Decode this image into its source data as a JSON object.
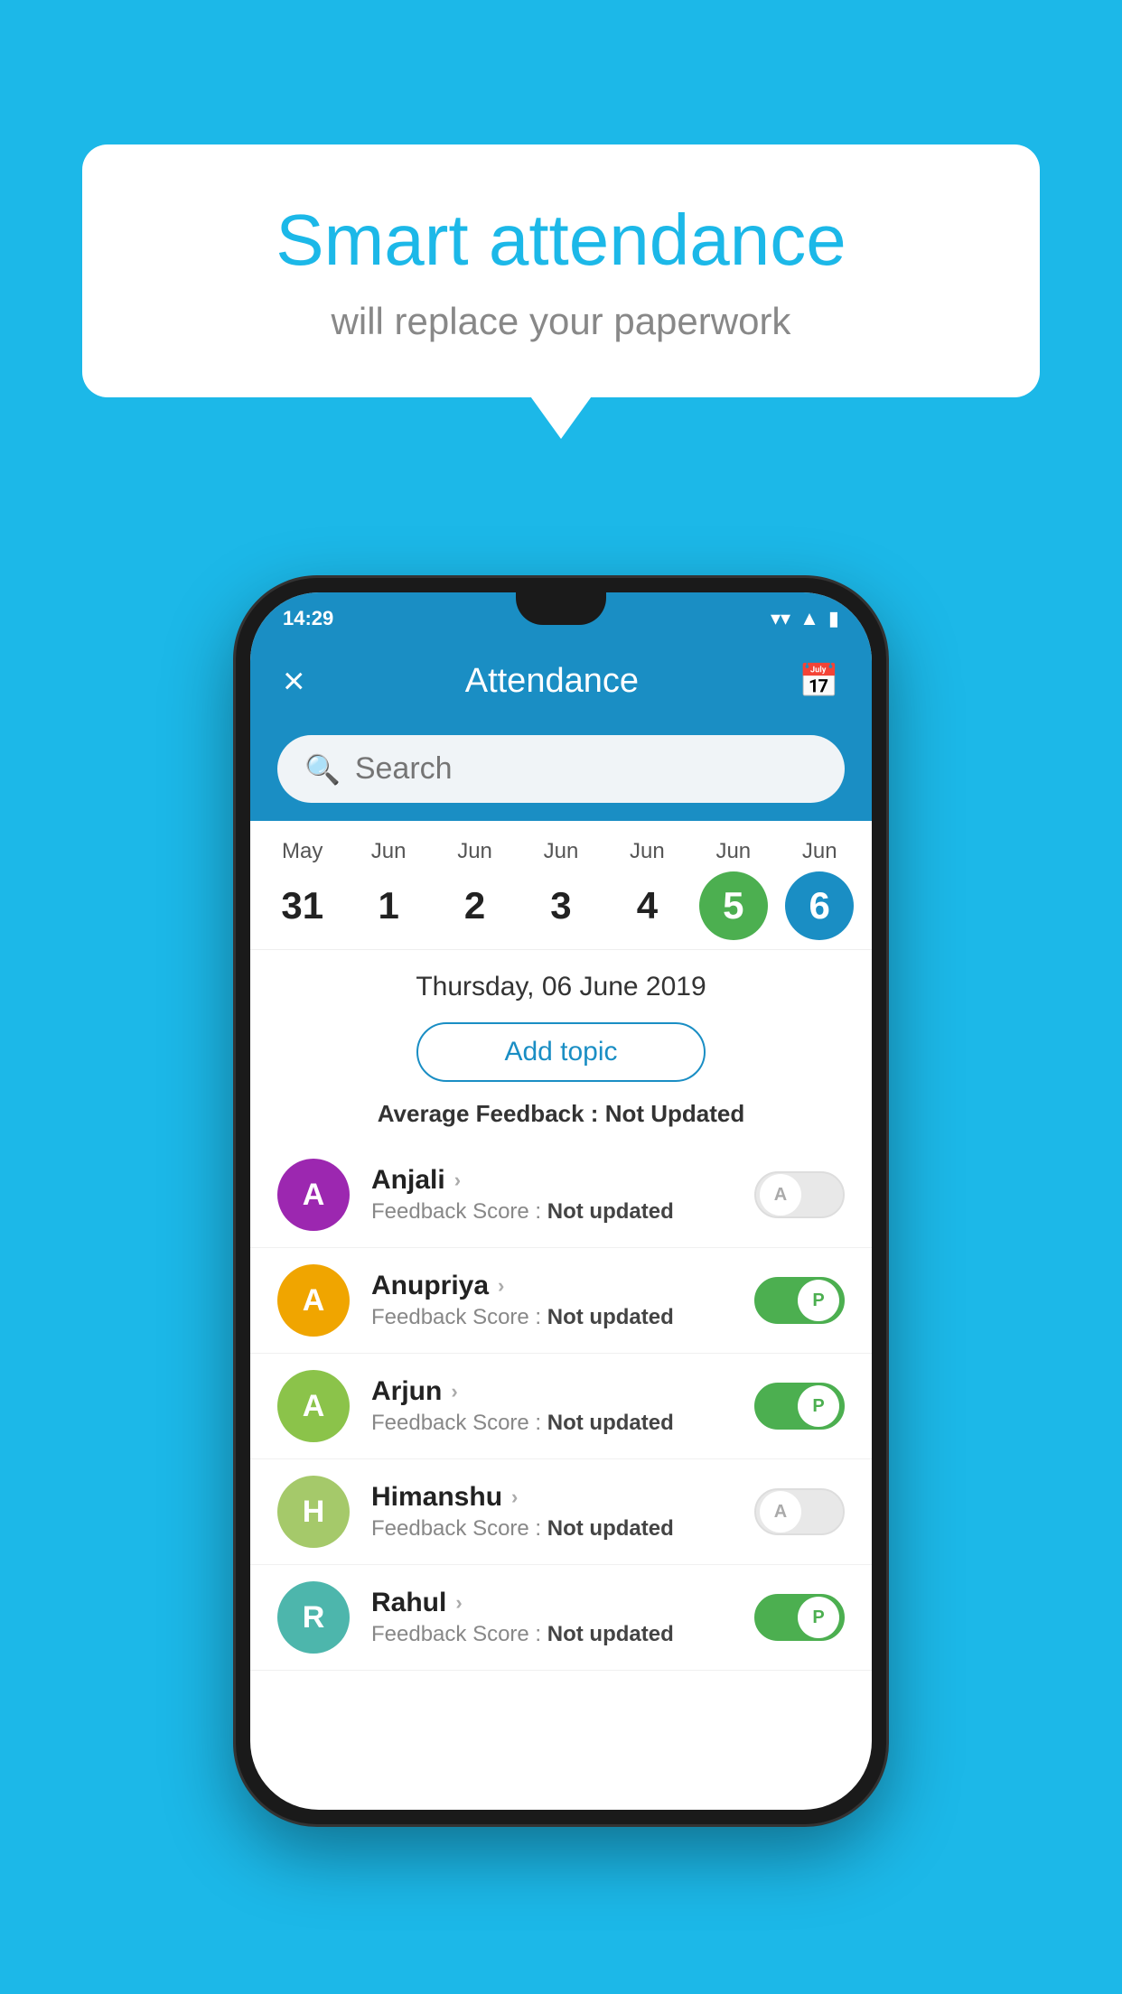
{
  "background": {
    "color": "#1cb8e8"
  },
  "speech_bubble": {
    "title": "Smart attendance",
    "subtitle": "will replace your paperwork"
  },
  "status_bar": {
    "time": "14:29",
    "icons": [
      "wifi",
      "signal",
      "battery"
    ]
  },
  "app_header": {
    "title": "Attendance",
    "close_label": "×",
    "calendar_label": "📅"
  },
  "search": {
    "placeholder": "Search"
  },
  "calendar": {
    "days": [
      {
        "month": "May",
        "day": "31",
        "state": "normal"
      },
      {
        "month": "Jun",
        "day": "1",
        "state": "normal"
      },
      {
        "month": "Jun",
        "day": "2",
        "state": "normal"
      },
      {
        "month": "Jun",
        "day": "3",
        "state": "normal"
      },
      {
        "month": "Jun",
        "day": "4",
        "state": "normal"
      },
      {
        "month": "Jun",
        "day": "5",
        "state": "today"
      },
      {
        "month": "Jun",
        "day": "6",
        "state": "selected"
      }
    ]
  },
  "date_display": "Thursday, 06 June 2019",
  "add_topic_label": "Add topic",
  "avg_feedback": {
    "label": "Average Feedback : ",
    "value": "Not Updated"
  },
  "students": [
    {
      "name": "Anjali",
      "initial": "A",
      "avatar_color": "#9c27b0",
      "feedback_label": "Feedback Score : ",
      "feedback_value": "Not updated",
      "toggle_state": "off",
      "toggle_letter": "A"
    },
    {
      "name": "Anupriya",
      "initial": "A",
      "avatar_color": "#f0a500",
      "feedback_label": "Feedback Score : ",
      "feedback_value": "Not updated",
      "toggle_state": "on",
      "toggle_letter": "P"
    },
    {
      "name": "Arjun",
      "initial": "A",
      "avatar_color": "#8bc34a",
      "feedback_label": "Feedback Score : ",
      "feedback_value": "Not updated",
      "toggle_state": "on",
      "toggle_letter": "P"
    },
    {
      "name": "Himanshu",
      "initial": "H",
      "avatar_color": "#a5c96a",
      "feedback_label": "Feedback Score : ",
      "feedback_value": "Not updated",
      "toggle_state": "off",
      "toggle_letter": "A"
    },
    {
      "name": "Rahul",
      "initial": "R",
      "avatar_color": "#4db6ac",
      "feedback_label": "Feedback Score : ",
      "feedback_value": "Not updated",
      "toggle_state": "on",
      "toggle_letter": "P"
    }
  ]
}
